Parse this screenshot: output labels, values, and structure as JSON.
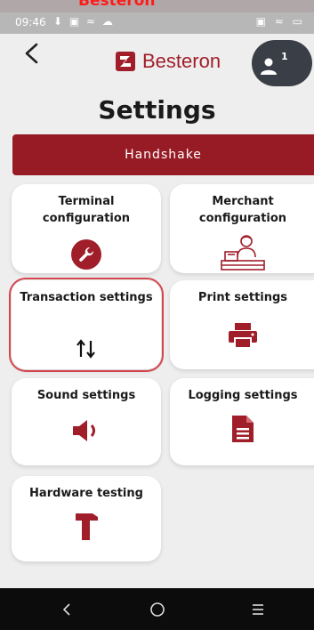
{
  "status_bar": {
    "time": "09:46",
    "left_icons": "⬇ ▣ ≈ ☁",
    "right_icons": "▣ ≈ ▭"
  },
  "banner": {
    "text": "Besteron"
  },
  "header": {
    "logo_text": "Besteron",
    "notification_count": "1",
    "page_title": "Settings"
  },
  "handshake_label": "Handshake",
  "tiles": [
    {
      "label": "Terminal configuration",
      "icon": "wrench-icon"
    },
    {
      "label": "Merchant configuration",
      "icon": "cashier-icon"
    },
    {
      "label": "Transaction settings",
      "icon": "sort-arrows-icon"
    },
    {
      "label": "Print settings",
      "icon": "printer-icon"
    },
    {
      "label": "Sound settings",
      "icon": "speaker-icon"
    },
    {
      "label": "Logging settings",
      "icon": "document-icon"
    },
    {
      "label": "Hardware testing",
      "icon": "hammer-icon"
    }
  ],
  "selected_tile": "Transaction settings",
  "colors": {
    "brand": "#961b24",
    "icon_red": "#a01e2a",
    "selection_outline": "#d4474f"
  },
  "nav": {
    "back": "‹",
    "home": "○",
    "menu": "≡"
  }
}
